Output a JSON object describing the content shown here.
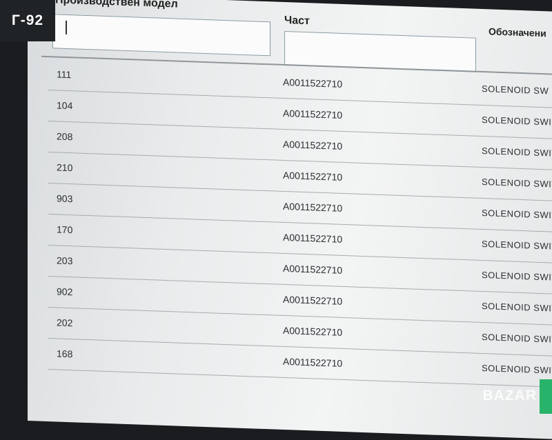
{
  "overlay_label": "Г-92",
  "columns": {
    "model_header": "Производствен модел",
    "part_header": "Част",
    "description_header": "Обозначени"
  },
  "rows": [
    {
      "model": "111",
      "part": "A0011522710",
      "description": "SOLENOID SW"
    },
    {
      "model": "104",
      "part": "A0011522710",
      "description": "SOLENOID SWI"
    },
    {
      "model": "208",
      "part": "A0011522710",
      "description": "SOLENOID SWIT"
    },
    {
      "model": "210",
      "part": "A0011522710",
      "description": "SOLENOID SWIT"
    },
    {
      "model": "903",
      "part": "A0011522710",
      "description": "SOLENOID SWITC"
    },
    {
      "model": "170",
      "part": "A0011522710",
      "description": "SOLENOID SWITC"
    },
    {
      "model": "203",
      "part": "A0011522710",
      "description": "SOLENOID SWITCH"
    },
    {
      "model": "902",
      "part": "A0011522710",
      "description": "SOLENOID SWITCH"
    },
    {
      "model": "202",
      "part": "A0011522710",
      "description": "SOLENOID SWITCH"
    },
    {
      "model": "168",
      "part": "A0011522710",
      "description": "SOLENOID SWITCH"
    }
  ],
  "watermark": "BAZAR",
  "colors": {
    "accent": "#28b36a"
  }
}
